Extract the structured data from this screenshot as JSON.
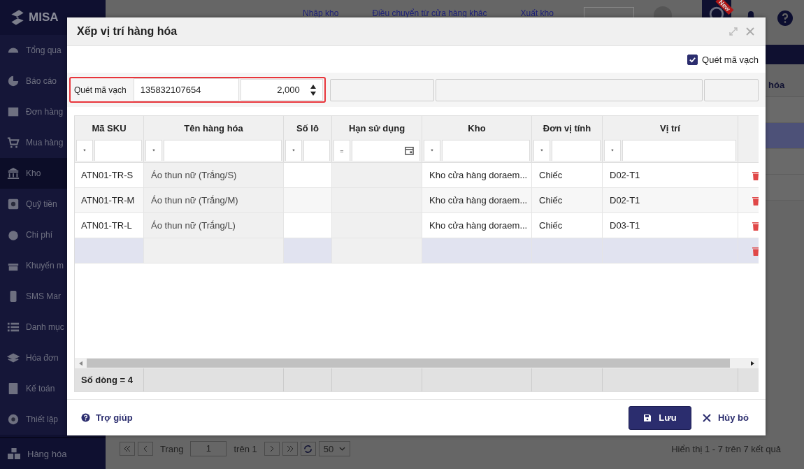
{
  "app": {
    "logo": {
      "brand": "MISA"
    },
    "sidebar": {
      "items": [
        {
          "label": "Tổng qua",
          "selected": false
        },
        {
          "label": "Báo cáo",
          "selected": false
        },
        {
          "label": "Đơn hàng",
          "selected": false
        },
        {
          "label": "Mua hàng",
          "selected": false
        },
        {
          "label": "Kho",
          "selected": true
        },
        {
          "label": "Quỹ tiền",
          "selected": false
        },
        {
          "label": "Chi phí",
          "selected": false
        },
        {
          "label": "Khuyến m",
          "selected": false
        },
        {
          "label": "SMS Mar",
          "selected": false
        },
        {
          "label": "Danh mục",
          "selected": false
        },
        {
          "label": "Hóa đơn",
          "selected": false
        },
        {
          "label": "Kế toán",
          "selected": false
        },
        {
          "label": "Thiết lập",
          "selected": false
        }
      ],
      "bottom_item": {
        "label": "Hàng hóa"
      }
    },
    "header": {
      "links": [
        "Nhập kho",
        "Điều chuyển từ cửa hàng khác",
        "Xuất kho"
      ],
      "badge": "New"
    },
    "list": {
      "column_header": "hóa",
      "rows": [
        {
          "selected": false
        },
        {
          "selected": true
        },
        {
          "selected": false
        },
        {
          "selected": false
        }
      ]
    },
    "pagination": {
      "page_label": "Trang",
      "page": "1",
      "of_label": "trên 1",
      "page_size": "50",
      "summary": "Hiển thị 1 - 7 trên 7 kết quả"
    }
  },
  "dialog": {
    "title": "Xếp vị trí hàng hóa",
    "scan_toggle": {
      "label": "Quét mã vạch",
      "checked": true
    },
    "scan_bar": {
      "label": "Quét mã vạch",
      "barcode": "135832107654",
      "quantity": "2,000"
    },
    "table": {
      "columns": [
        {
          "label": "Mã SKU",
          "filter": "*",
          "kind": "text",
          "readonly": false
        },
        {
          "label": "Tên hàng hóa",
          "filter": "*",
          "kind": "text",
          "readonly": true
        },
        {
          "label": "Số lô",
          "filter": "*",
          "kind": "text",
          "readonly": false
        },
        {
          "label": "Hạn sử dụng",
          "filter": "=",
          "kind": "date",
          "readonly": true
        },
        {
          "label": "Kho",
          "filter": "*",
          "kind": "text",
          "readonly": false
        },
        {
          "label": "Đơn vị tính",
          "filter": "*",
          "kind": "text",
          "readonly": false
        },
        {
          "label": "Vị trí",
          "filter": "*",
          "kind": "text",
          "readonly": false
        }
      ],
      "rows": [
        {
          "sku": "ATN01-TR-S",
          "name": "Áo thun nữ (Trắng/S)",
          "warehouse": "Kho cửa hàng doraem...",
          "unit": "Chiếc",
          "location": "D02-T1",
          "selected": false
        },
        {
          "sku": "ATN01-TR-M",
          "name": "Áo thun nữ (Trắng/M)",
          "warehouse": "Kho cửa hàng doraem...",
          "unit": "Chiếc",
          "location": "D02-T1",
          "selected": false
        },
        {
          "sku": "ATN01-TR-L",
          "name": "Áo thun nữ (Trắng/L)",
          "warehouse": "Kho cửa hàng doraem...",
          "unit": "Chiếc",
          "location": "D03-T1",
          "selected": false
        },
        {
          "selected": true
        }
      ],
      "footer": "Số dòng = 4"
    },
    "help": "Trợ giúp",
    "buttons": {
      "save": "Lưu",
      "cancel": "Hủy bỏ"
    }
  }
}
